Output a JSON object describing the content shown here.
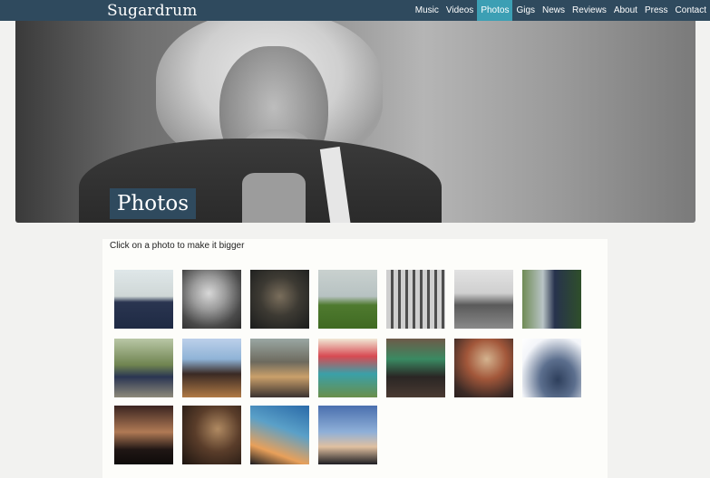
{
  "header": {
    "brand": "Sugardrum",
    "nav": [
      {
        "label": "Music",
        "active": false
      },
      {
        "label": "Videos",
        "active": false
      },
      {
        "label": "Photos",
        "active": true
      },
      {
        "label": "Gigs",
        "active": false
      },
      {
        "label": "News",
        "active": false
      },
      {
        "label": "Reviews",
        "active": false
      },
      {
        "label": "About",
        "active": false
      },
      {
        "label": "Press",
        "active": false
      },
      {
        "label": "Contact",
        "active": false
      }
    ]
  },
  "hero": {
    "title": "Photos"
  },
  "gallery": {
    "instruction": "Click on a photo to make it bigger",
    "photo_count": 18
  },
  "colors": {
    "header_bg": "#2f4a5e",
    "nav_active": "#3c9fb4"
  }
}
